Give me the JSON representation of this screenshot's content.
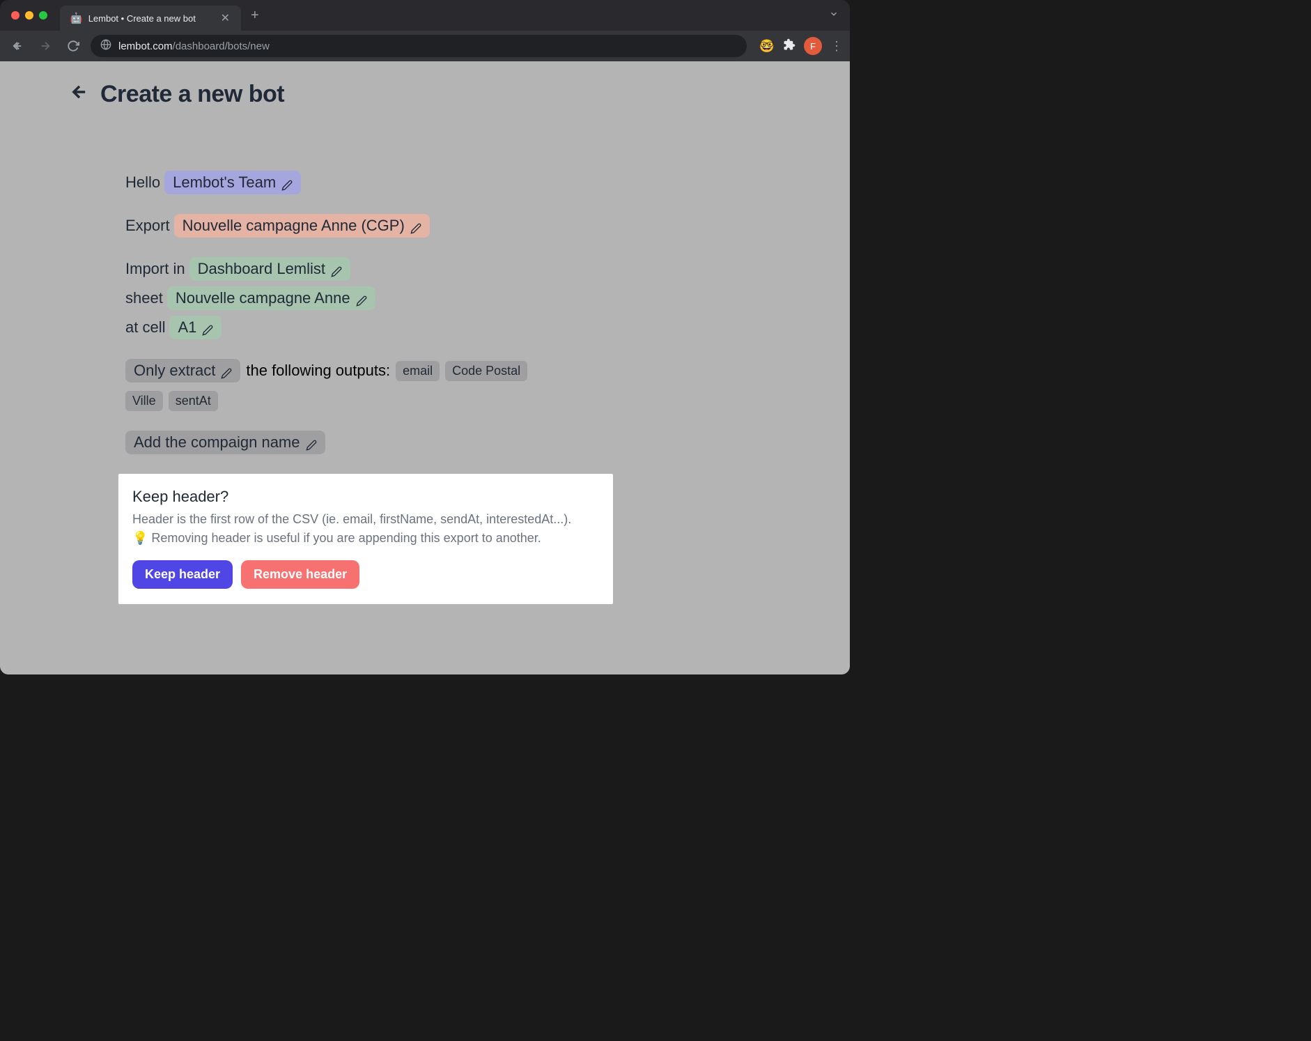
{
  "browser": {
    "tab_title": "Lembot • Create a new bot",
    "tab_favicon": "🤖",
    "url_domain": "lembot.com",
    "url_path": "/dashboard/bots/new",
    "avatar_initial": "F",
    "ext_emoji": "🤓"
  },
  "header": {
    "title": "Create a new bot"
  },
  "wizard": {
    "hello_label": "Hello",
    "team": "Lembot's Team",
    "export_label": "Export",
    "campaign": "Nouvelle campagne Anne (CGP)",
    "import_label": "Import in",
    "spreadsheet": "Dashboard Lemlist",
    "sheet_label": "sheet",
    "sheet_name": "Nouvelle campagne Anne",
    "cell_label": "at cell",
    "cell": "A1",
    "extract_mode": "Only extract",
    "outputs_label": "the following outputs:",
    "outputs": [
      "email",
      "Code Postal",
      "Ville",
      "sentAt"
    ],
    "add_campaign_name": "Add the compaign name"
  },
  "dialog": {
    "title": "Keep header?",
    "line1": "Header is the first row of the CSV (ie. email, firstName, sendAt, interestedAt...).",
    "line2": "💡 Removing header is useful if you are appending this export to another.",
    "keep_label": "Keep header",
    "remove_label": "Remove header"
  }
}
